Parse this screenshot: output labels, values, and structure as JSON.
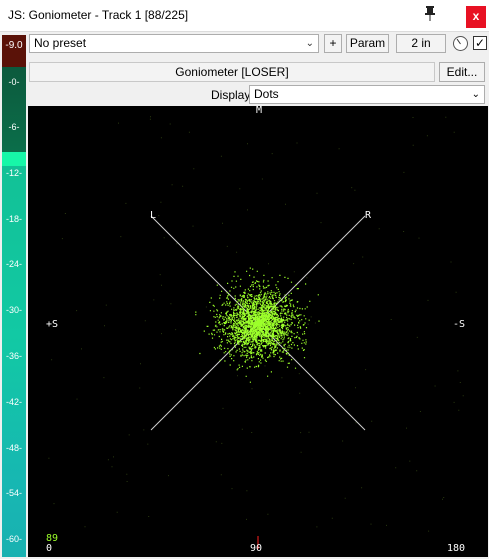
{
  "window": {
    "title": "JS: Goniometer - Track 1 [88/225]",
    "close_label": "x"
  },
  "toolbar": {
    "preset_value": "No preset",
    "plus_label": "+",
    "param_label": "Param",
    "io_label": "2 in",
    "checkbox_checked": true
  },
  "plugin": {
    "name": "Goniometer [LOSER]",
    "edit_label": "Edit..."
  },
  "display": {
    "label": "Display",
    "value": "Dots"
  },
  "vu_meter": {
    "peak_readout": "-9.0",
    "scale": [
      "-0-",
      "-6-",
      "-12-",
      "-18-",
      "-24-",
      "-30-",
      "-36-",
      "-42-",
      "-48-",
      "-54-",
      "-60-"
    ]
  },
  "scope": {
    "top_label": "M",
    "left_diag_label": "L",
    "right_diag_label": "R",
    "left_side_label": "+S",
    "right_side_label": "-S",
    "bottom_left_value": "0",
    "bottom_mid_value": "90",
    "bottom_right_value": "180",
    "correlation_readout": "89",
    "colors": {
      "background": "#000000",
      "dots": "#9cff2a",
      "axes": "#d0d0d0",
      "center_marker": "#ff2020"
    }
  }
}
